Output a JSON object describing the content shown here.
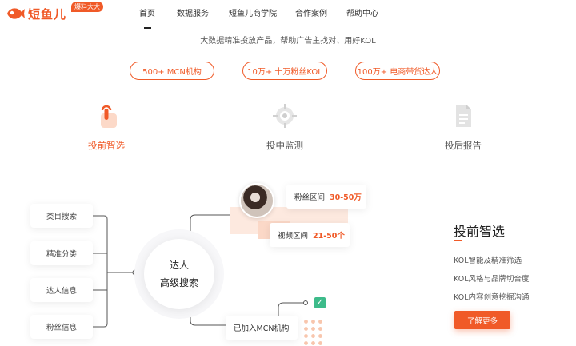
{
  "brand": {
    "name": "短鱼儿",
    "badge": "爆料大大",
    "accent": "#f05a28"
  },
  "nav": {
    "items": [
      {
        "label": "首页",
        "active": true
      },
      {
        "label": "数据服务"
      },
      {
        "label": "短鱼儿商学院"
      },
      {
        "label": "合作案例"
      },
      {
        "label": "帮助中心"
      }
    ]
  },
  "tagline": "大数据精准投放产品，帮助广告主找对、用好KOL",
  "pills": [
    "500+ MCN机构",
    "10万+ 十万粉丝KOL",
    "100万+ 电商带货达人"
  ],
  "features": [
    {
      "label": "投前智选",
      "icon": "touch-icon",
      "active": true
    },
    {
      "label": "投中监测",
      "icon": "target-icon"
    },
    {
      "label": "投后报告",
      "icon": "report-icon"
    }
  ],
  "diagram": {
    "categories": [
      "类目搜索",
      "精准分类",
      "达人信息",
      "粉丝信息"
    ],
    "hub_line1": "达人",
    "hub_line2": "高级搜索",
    "fans_range_label": "粉丝区间",
    "fans_range_value": "30-50万",
    "video_range_label": "视频区间",
    "video_range_value": "21-50个",
    "mcn_label": "已加入MCN机构"
  },
  "panel": {
    "title": "投前智选",
    "items": [
      "KOL智能及精准筛选",
      "KOL风格与品牌切合度",
      "KOL内容创意挖掘沟通"
    ],
    "cta": "了解更多"
  }
}
